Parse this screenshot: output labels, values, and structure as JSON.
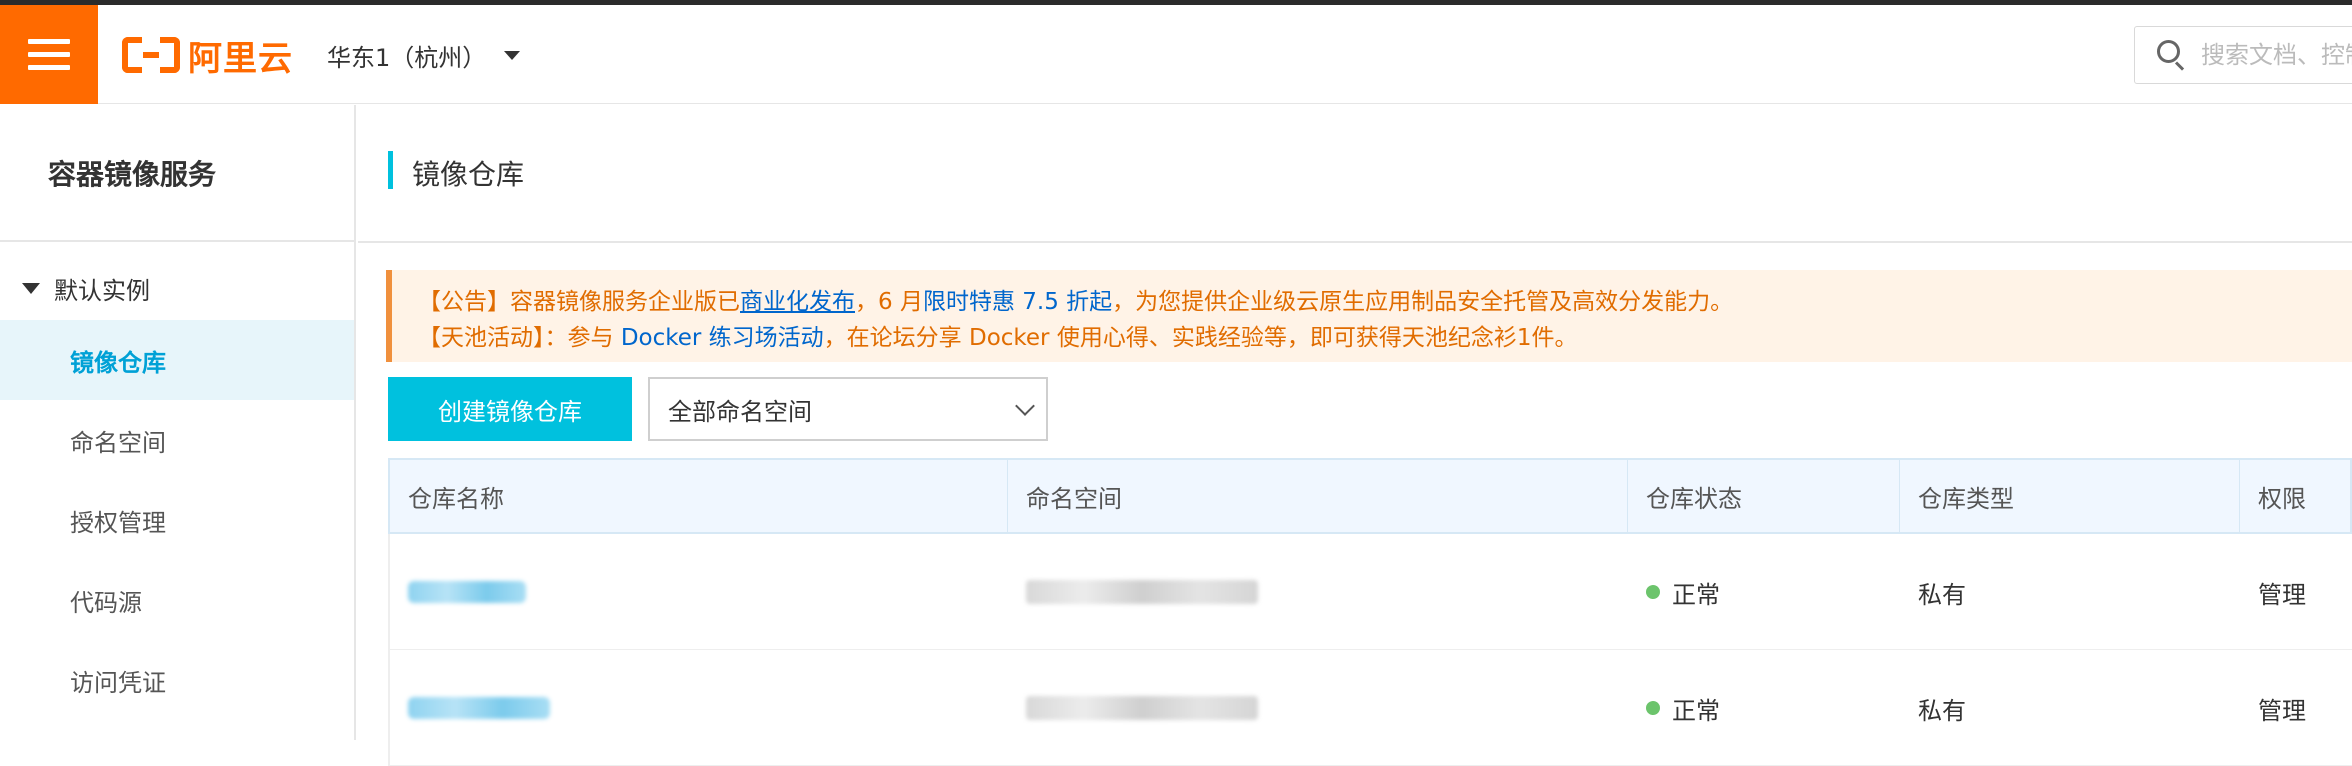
{
  "topbar": {
    "brand": "阿里云",
    "region": "华东1（杭州）",
    "search_placeholder": "搜索文档、控制台"
  },
  "sidebar": {
    "title": "容器镜像服务",
    "group": "默认实例",
    "items": [
      {
        "label": "镜像仓库",
        "active": true
      },
      {
        "label": "命名空间"
      },
      {
        "label": "授权管理"
      },
      {
        "label": "代码源"
      },
      {
        "label": "访问凭证"
      }
    ]
  },
  "main": {
    "page_title": "镜像仓库",
    "notice": {
      "line1_prefix": "【公告】容器镜像服务企业版已",
      "line1_link": "商业化发布",
      "line1_mid": "，6 月",
      "line1_promo": "限时特惠 7.5 折起",
      "line1_suffix": "，为您提供企业级云原生应用制品安全托管及高效分发能力。",
      "line2_prefix": "【天池活动】：参与 ",
      "line2_link": "Docker 练习场活动",
      "line2_suffix": "，在论坛分享 Docker 使用心得、实践经验等，即可获得天池纪念衫1件。"
    },
    "create_button": "创建镜像仓库",
    "namespace_select": "全部命名空间",
    "table": {
      "headers": [
        "仓库名称",
        "命名空间",
        "仓库状态",
        "仓库类型",
        "权限"
      ],
      "rows": [
        {
          "status": "正常",
          "type": "私有",
          "permission": "管理"
        },
        {
          "status": "正常",
          "type": "私有",
          "permission": "管理"
        }
      ]
    }
  },
  "colors": {
    "brand": "#ff6a00",
    "accent": "#00c1de",
    "status_ok": "#6cc46c",
    "notice_text": "#e06c00"
  }
}
